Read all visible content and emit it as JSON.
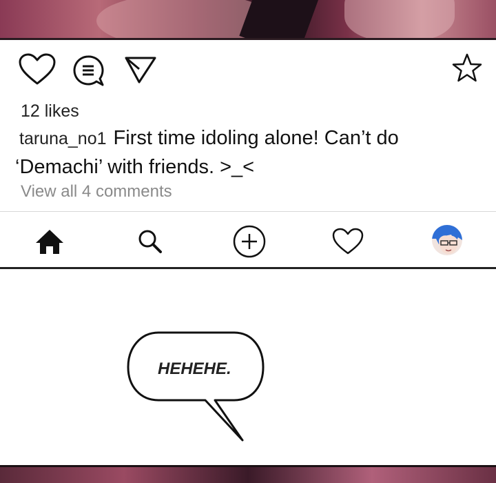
{
  "post": {
    "likes": "12 likes",
    "username": "taruna_no1",
    "caption_line1": "First time idoling alone! Can’t do",
    "caption_line2": "‘Demachi’ with friends. >_<",
    "view_comments": "View all 4 comments"
  },
  "action_icons": [
    "heart-icon",
    "comment-icon",
    "send-icon",
    "bookmark-star-icon"
  ],
  "nav_icons": [
    "home-icon",
    "search-icon",
    "add-icon",
    "activity-heart-icon",
    "profile-avatar"
  ],
  "speech_bubble": {
    "text": "HEHEHE."
  },
  "colors": {
    "text": "#222222",
    "muted": "#8a8a8a",
    "divider": "#d8d8d8"
  }
}
